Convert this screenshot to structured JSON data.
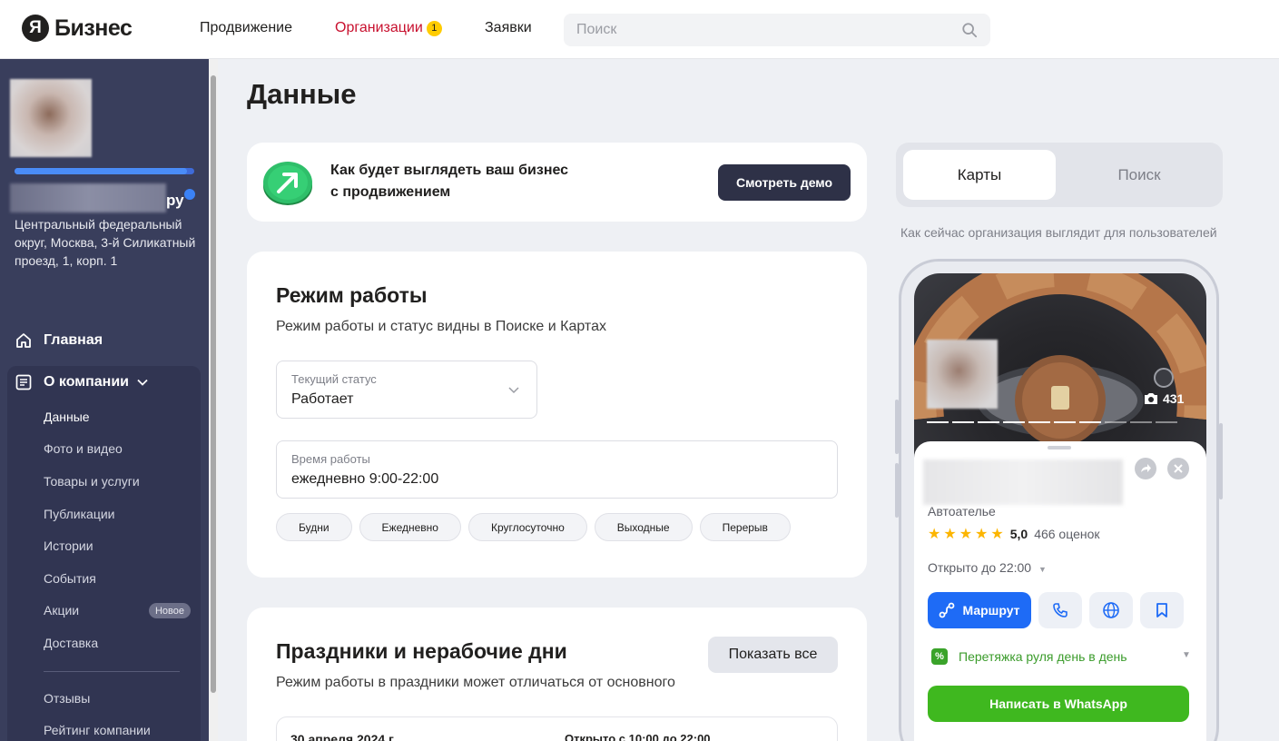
{
  "header": {
    "logo_letter": "Я",
    "logo_text": "Бизнес",
    "nav": [
      {
        "label": "Продвижение"
      },
      {
        "label": "Организации",
        "badge": "1"
      },
      {
        "label": "Заявки"
      }
    ],
    "search_placeholder": "Поиск"
  },
  "sidebar": {
    "org_name_suffix": "ру",
    "address": "Центральный федеральный округ, Москва, 3-й Силикатный проезд, 1, корп. 1",
    "main_item": "Главная",
    "about_section": "О компании",
    "sub_items": [
      {
        "label": "Данные"
      },
      {
        "label": "Фото и видео"
      },
      {
        "label": "Товары и услуги"
      },
      {
        "label": "Публикации"
      },
      {
        "label": "Истории"
      },
      {
        "label": "События"
      },
      {
        "label": "Акции",
        "badge": "Новое"
      },
      {
        "label": "Доставка"
      },
      {
        "label": "Отзывы"
      },
      {
        "label": "Рейтинг компании"
      }
    ],
    "profile_progress_pct": 96
  },
  "main": {
    "title": "Данные",
    "promo": {
      "text_line1": "Как будет выглядеть ваш бизнес",
      "text_line2": "с продвижением",
      "button": "Смотреть демо"
    },
    "schedule": {
      "title": "Режим работы",
      "subtitle": "Режим работы и статус видны в Поиске и Картах",
      "status_label": "Текущий статус",
      "status_value": "Работает",
      "hours_label": "Время работы",
      "hours_value": "ежедневно 9:00-22:00",
      "chips": [
        "Будни",
        "Ежедневно",
        "Круглосуточно",
        "Выходные",
        "Перерыв"
      ]
    },
    "holidays": {
      "title": "Праздники и нерабочие дни",
      "subtitle": "Режим работы в праздники может отличаться от основного",
      "show_all": "Показать все",
      "first_date": "30 апреля 2024 г.",
      "first_time": "Открыто с 10:00 до 22:00"
    }
  },
  "preview": {
    "tabs": [
      "Карты",
      "Поиск"
    ],
    "caption": "Как сейчас организация выглядит для пользователей",
    "photo_count": "431",
    "category": "Автоателье",
    "rating": "5,0",
    "rating_count": "466 оценок",
    "open_status": "Открыто до 22:00",
    "route_button": "Маршрут",
    "promo_text": "Перетяжка руля день в день",
    "promo_badge": "%",
    "whatsapp_button": "Написать в WhatsApp",
    "star_count": 5
  },
  "colors": {
    "accent_red": "#c8102e",
    "sidebar_bg": "#393e5c",
    "primary_blue": "#1e6bf6",
    "whatsapp_green": "#3fb81f",
    "star_yellow": "#fcb500"
  }
}
